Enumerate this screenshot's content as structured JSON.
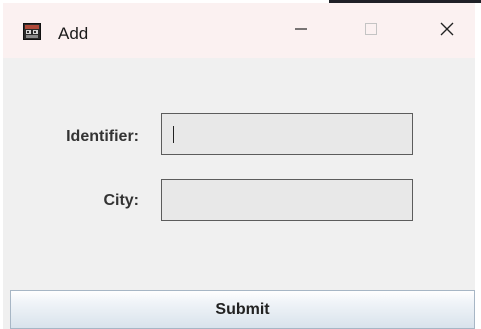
{
  "window": {
    "title": "Add",
    "app_icon": "app-window-icon",
    "controls": {
      "minimize_icon": "minimize-icon",
      "maximize_icon": "maximize-icon",
      "close_icon": "close-icon"
    }
  },
  "form": {
    "identifier_label": "Identifier:",
    "identifier_value": "",
    "city_label": "City:",
    "city_value": ""
  },
  "submit_label": "Submit",
  "colors": {
    "titlebar": "#fbf1f1",
    "window_bg": "#f0f0f0",
    "field_bg": "#e8e8e8",
    "field_border": "#5c5c5c"
  }
}
